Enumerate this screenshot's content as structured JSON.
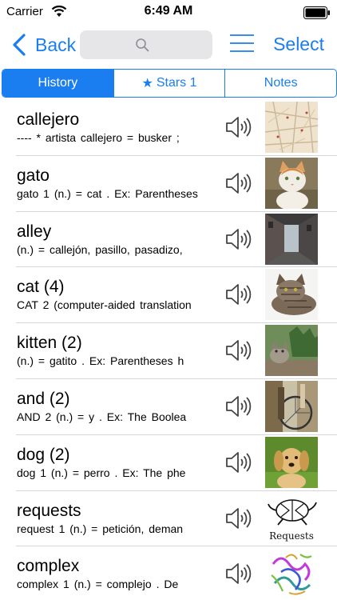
{
  "status_bar": {
    "carrier": "Carrier",
    "time": "6:49 AM",
    "icons": [
      "wifi-icon",
      "battery-icon"
    ]
  },
  "nav": {
    "back_label": "Back",
    "select_label": "Select",
    "icons": [
      "chevron-left-icon",
      "search-icon",
      "menu-icon"
    ]
  },
  "tabs": [
    {
      "label": "History",
      "active": true
    },
    {
      "label": "Stars 1",
      "icon": "star-icon",
      "active": false
    },
    {
      "label": "Notes",
      "active": false
    }
  ],
  "colors": {
    "accent": "#1a7ef0",
    "separator": "#d6d6da",
    "search_bg": "#e6e6e9"
  },
  "entries": [
    {
      "title": "callejero",
      "definition": "----   * artista callejero  =  busker ;",
      "image": "street-map-image"
    },
    {
      "title": "gato",
      "definition": "gato 1  (n.)  =  cat .  Ex:  Parentheses",
      "image": "cat-photo"
    },
    {
      "title": "alley",
      "definition": " (n.)  =  callejón, pasillo, pasadizo,",
      "image": "alley-photo"
    },
    {
      "title": "cat (4)",
      "definition": "CAT 2  (computer-aided translation",
      "image": "tabby-cat-photo"
    },
    {
      "title": "kitten (2)",
      "definition": " (n.)  =  gatito .  Ex:  Parentheses h",
      "image": "kitten-photo"
    },
    {
      "title": "and (2)",
      "definition": "AND 2  (n.)  =  y .  Ex:  The Boolea",
      "image": "bicycle-photo"
    },
    {
      "title": "dog (2)",
      "definition": "dog 1  (n.)  =  perro .  Ex:  The phe",
      "image": "puppy-photo"
    },
    {
      "title": "requests",
      "definition": "request 1  (n.)  =  petición, deman",
      "image": "requests-logo",
      "image_caption": "Requests"
    },
    {
      "title": "complex",
      "definition": "complex 1  (n.)  =  complejo .  De",
      "image": "molecule-image"
    }
  ]
}
